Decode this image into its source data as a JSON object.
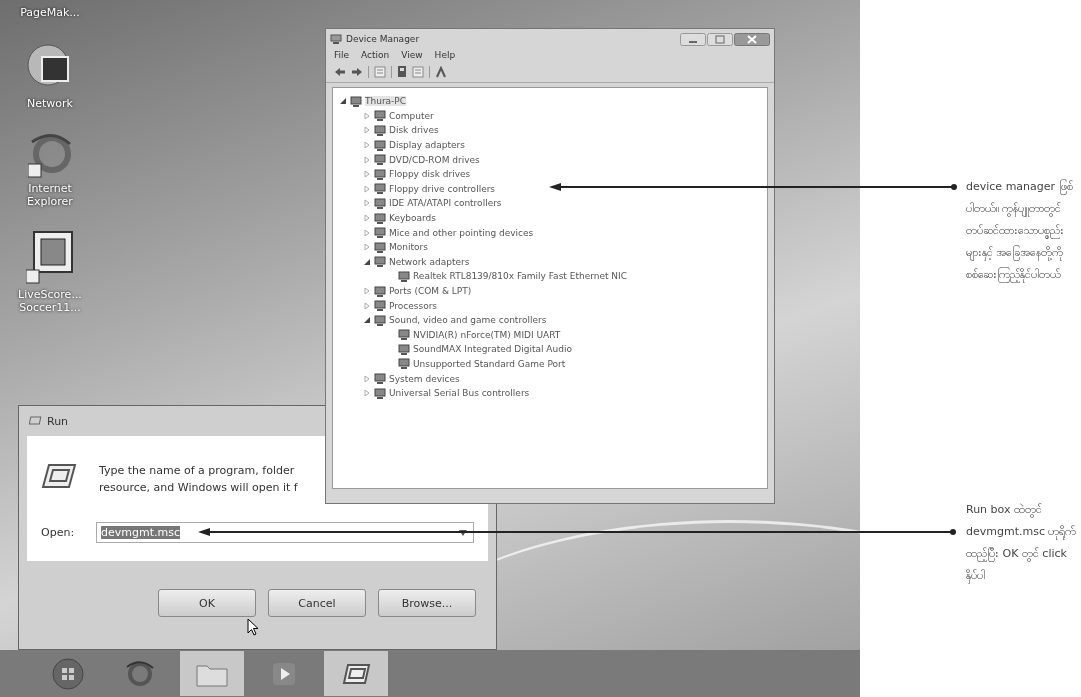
{
  "desktop": {
    "icons": [
      {
        "label": "PageMak...",
        "kind": "cut"
      },
      {
        "label": "Network",
        "kind": "network"
      },
      {
        "label": "Internet Explorer",
        "kind": "browser"
      },
      {
        "label": "LiveScore... Soccer11...",
        "kind": "shortcut-app"
      }
    ]
  },
  "device_manager": {
    "title": "Device Manager",
    "menu": [
      "File",
      "Action",
      "View",
      "Help"
    ],
    "tree": {
      "label": "Thura-PC",
      "expanded": true,
      "selected": true,
      "children": [
        {
          "label": "Computer",
          "expanded": false,
          "selected": false
        },
        {
          "label": "Disk drives",
          "expanded": false,
          "selected": false
        },
        {
          "label": "Display adapters",
          "expanded": false,
          "selected": false
        },
        {
          "label": "DVD/CD-ROM drives",
          "expanded": false,
          "selected": false
        },
        {
          "label": "Floppy disk drives",
          "expanded": false,
          "selected": false
        },
        {
          "label": "Floppy drive controllers",
          "expanded": false,
          "selected": false
        },
        {
          "label": "IDE ATA/ATAPI controllers",
          "expanded": false,
          "selected": false
        },
        {
          "label": "Keyboards",
          "expanded": false,
          "selected": false
        },
        {
          "label": "Mice and other pointing devices",
          "expanded": false,
          "selected": false
        },
        {
          "label": "Monitors",
          "expanded": false,
          "selected": false
        },
        {
          "label": "Network adapters",
          "expanded": true,
          "selected": false,
          "children": [
            {
              "label": "Realtek RTL8139/810x Family Fast Ethernet NIC",
              "selected": false
            }
          ]
        },
        {
          "label": "Ports (COM & LPT)",
          "expanded": false,
          "selected": false
        },
        {
          "label": "Processors",
          "expanded": false,
          "selected": false
        },
        {
          "label": "Sound, video and game controllers",
          "expanded": true,
          "selected": false,
          "children": [
            {
              "label": "NVIDIA(R) nForce(TM) MIDI UART",
              "selected": false
            },
            {
              "label": "SoundMAX Integrated Digital Audio",
              "selected": false
            },
            {
              "label": "Unsupported Standard Game Port",
              "selected": false
            }
          ]
        },
        {
          "label": "System devices",
          "expanded": false,
          "selected": false
        },
        {
          "label": "Universal Serial Bus controllers",
          "expanded": false,
          "selected": false
        }
      ]
    }
  },
  "run_dialog": {
    "title": "Run",
    "lines": [
      "Type the name of a program, folder",
      "resource, and Windows will open it f"
    ],
    "open_label": "Open:",
    "value": "devmgmt.msc",
    "value_selected": true,
    "buttons": [
      "OK",
      "Cancel",
      "Browse..."
    ]
  },
  "taskbar": {
    "items": [
      {
        "kind": "start",
        "open": false
      },
      {
        "kind": "browser",
        "open": false
      },
      {
        "kind": "folder",
        "open": true
      },
      {
        "kind": "media",
        "open": false
      },
      {
        "kind": "run",
        "open": true
      }
    ]
  },
  "annotations": [
    {
      "text": "device manager ဖြစ်ပါတယ်။ ကွန်ပျူတာတွင် တပ်ဆင်ထားသောပစ္စည်းများနှင့် အခြေအနေတို့ကို စစ်ဆေးကြည့်နိုင်ပါတယ်"
    },
    {
      "text": "Run box ထဲတွင် devmgmt.msc ဟုရိုက်ထည့်ပြီး OK တွင် click နှိပ်ပါ"
    }
  ]
}
